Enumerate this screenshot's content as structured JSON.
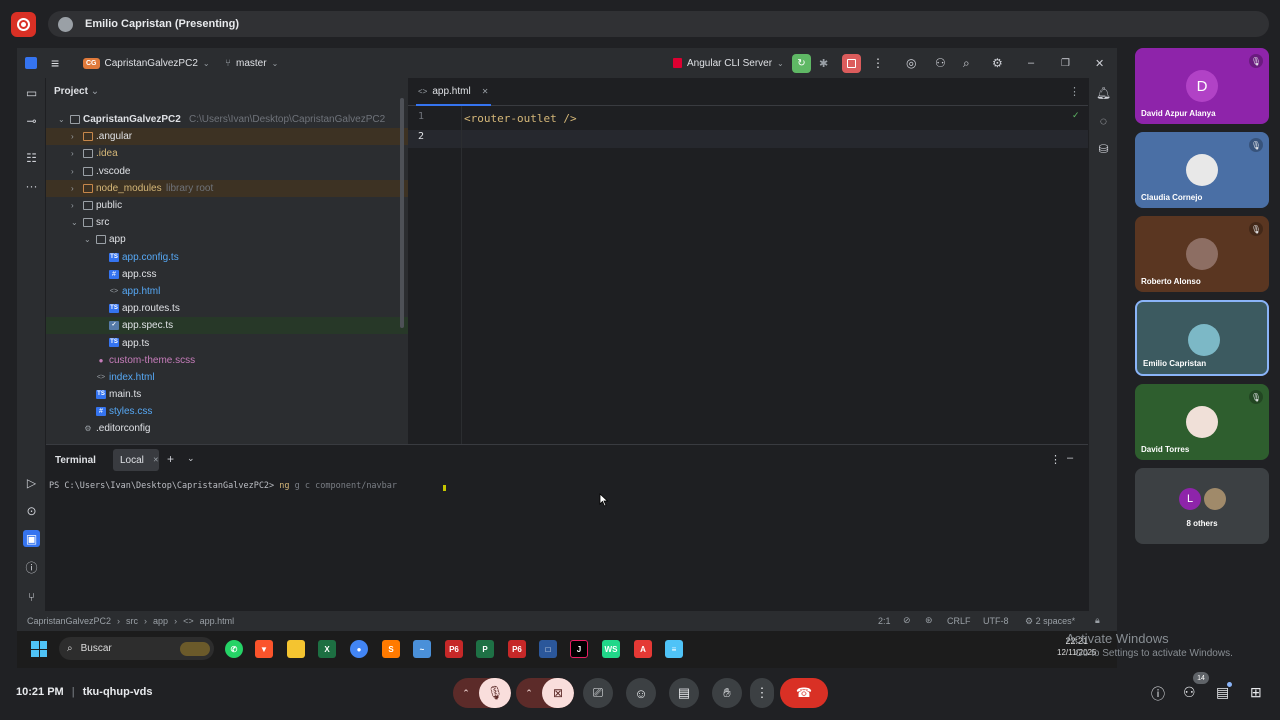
{
  "meet": {
    "presenting_label": "Emilio Capristan (Presenting)",
    "time": "10:21 PM",
    "meeting_code": "tku-qhup-vds",
    "participants_count": "14",
    "tiles": [
      {
        "name": "David Azpur Alanya",
        "initial": "D",
        "bg": "#8e24aa",
        "avatar_bg": "#b142c6",
        "muted": true
      },
      {
        "name": "Claudia Cornejo",
        "initial": "",
        "bg": "#4a6fa5",
        "avatar_bg": "#e8e8e8",
        "muted": true
      },
      {
        "name": "Roberto Alonso",
        "initial": "",
        "bg": "#5a3621",
        "avatar_bg": "#8d6e63",
        "muted": true
      },
      {
        "name": "Emilio Capristan",
        "initial": "",
        "bg": "#3c5a60",
        "avatar_bg": "#7cb8c6",
        "muted": false
      },
      {
        "name": "David Torres",
        "initial": "",
        "bg": "#2e5e2e",
        "avatar_bg": "#f0e0d8",
        "muted": true
      },
      {
        "name": "8 others",
        "initial": "L",
        "bg": "#3c4043",
        "avatar_bg": "#8e24aa",
        "muted": false
      }
    ],
    "colors": {
      "end_call": "#d93025",
      "muted_bg": "#f9dedc",
      "muted_arrow_bg": "#5c2b29"
    }
  },
  "ide": {
    "project_badge": "CG",
    "project_name": "CapristanGalvezPC2",
    "branch": "master",
    "run_config": "Angular CLI Server",
    "project_panel_title": "Project",
    "tree": [
      {
        "label": "CapristanGalvezPC2",
        "extra": "C:\\Users\\Ivan\\Desktop\\CapristanGalvezPC2",
        "depth": 0,
        "arrow": "⌄",
        "icon": "folder",
        "color": "#dfe1e5",
        "bg": ""
      },
      {
        "label": ".angular",
        "extra": "",
        "depth": 1,
        "arrow": "›",
        "icon": "folder-orange",
        "color": "#dfe1e5",
        "bg": "orange"
      },
      {
        "label": ".idea",
        "extra": "",
        "depth": 1,
        "arrow": "›",
        "icon": "folder",
        "color": "#d5b778",
        "bg": ""
      },
      {
        "label": ".vscode",
        "extra": "",
        "depth": 1,
        "arrow": "›",
        "icon": "folder",
        "color": "#dfe1e5",
        "bg": ""
      },
      {
        "label": "node_modules",
        "extra": "library root",
        "depth": 1,
        "arrow": "›",
        "icon": "folder-orange",
        "color": "#d5b778",
        "bg": "orange"
      },
      {
        "label": "public",
        "extra": "",
        "depth": 1,
        "arrow": "›",
        "icon": "folder",
        "color": "#dfe1e5",
        "bg": ""
      },
      {
        "label": "src",
        "extra": "",
        "depth": 1,
        "arrow": "⌄",
        "icon": "folder",
        "color": "#dfe1e5",
        "bg": ""
      },
      {
        "label": "app",
        "extra": "",
        "depth": 2,
        "arrow": "⌄",
        "icon": "folder",
        "color": "#dfe1e5",
        "bg": ""
      },
      {
        "label": "app.config.ts",
        "extra": "",
        "depth": 3,
        "arrow": "",
        "icon": "ts",
        "color": "#56a8f5",
        "bg": ""
      },
      {
        "label": "app.css",
        "extra": "",
        "depth": 3,
        "arrow": "",
        "icon": "css",
        "color": "#dfe1e5",
        "bg": ""
      },
      {
        "label": "app.html",
        "extra": "",
        "depth": 3,
        "arrow": "",
        "icon": "html",
        "color": "#56a8f5",
        "bg": ""
      },
      {
        "label": "app.routes.ts",
        "extra": "",
        "depth": 3,
        "arrow": "",
        "icon": "ts",
        "color": "#dfe1e5",
        "bg": ""
      },
      {
        "label": "app.spec.ts",
        "extra": "",
        "depth": 3,
        "arrow": "",
        "icon": "spec",
        "color": "#dfe1e5",
        "bg": "green"
      },
      {
        "label": "app.ts",
        "extra": "",
        "depth": 3,
        "arrow": "",
        "icon": "ts",
        "color": "#dfe1e5",
        "bg": ""
      },
      {
        "label": "custom-theme.scss",
        "extra": "",
        "depth": 2,
        "arrow": "",
        "icon": "scss",
        "color": "#c77dbb",
        "bg": ""
      },
      {
        "label": "index.html",
        "extra": "",
        "depth": 2,
        "arrow": "",
        "icon": "html",
        "color": "#56a8f5",
        "bg": ""
      },
      {
        "label": "main.ts",
        "extra": "",
        "depth": 2,
        "arrow": "",
        "icon": "ts",
        "color": "#dfe1e5",
        "bg": ""
      },
      {
        "label": "styles.css",
        "extra": "",
        "depth": 2,
        "arrow": "",
        "icon": "css",
        "color": "#56a8f5",
        "bg": ""
      },
      {
        "label": ".editorconfig",
        "extra": "",
        "depth": 1,
        "arrow": "",
        "icon": "gear",
        "color": "#dfe1e5",
        "bg": ""
      }
    ],
    "editor_tab": "app.html",
    "line_numbers": [
      "1",
      "2"
    ],
    "code_line_1": "<router-outlet />",
    "terminal_title": "Terminal",
    "terminal_tab": "Local",
    "terminal_prompt": "PS C:\\Users\\Ivan\\Desktop\\CapristanGalvezPC2>",
    "terminal_cmd_ng": "ng",
    "terminal_cmd_rest": "g c component/navbar",
    "breadcrumb": [
      "CapristanGalvezPC2",
      "src",
      "app",
      "app.html"
    ],
    "status": {
      "position": "2:1",
      "line_sep": "CRLF",
      "encoding": "UTF-8",
      "indent": "2 spaces*"
    }
  },
  "windows": {
    "search_placeholder": "Buscar",
    "clock_time": "22:21",
    "clock_date": "12/11/2025",
    "activate_title": "Activate Windows",
    "activate_sub": "Go to Settings to activate Windows."
  }
}
